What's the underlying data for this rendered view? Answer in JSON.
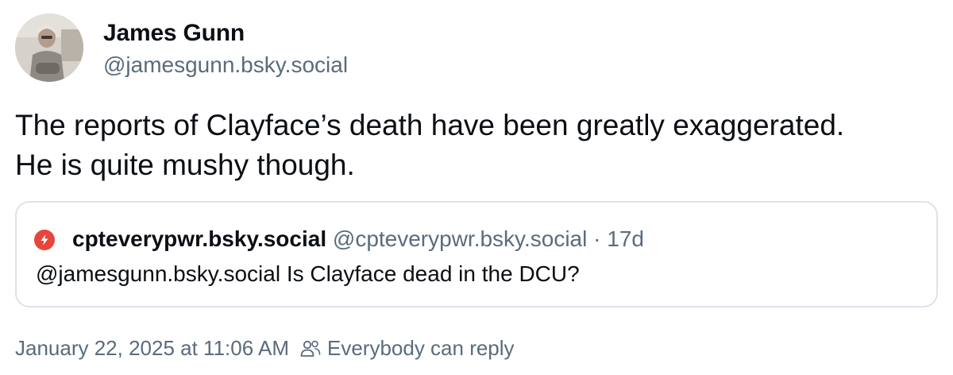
{
  "author": {
    "display_name": "James Gunn",
    "handle": "@jamesgunn.bsky.social",
    "avatar_icon": "profile-photo"
  },
  "post": {
    "text_lines": [
      "The reports of Clayface’s death have been greatly exaggerated.",
      "He is quite mushy though."
    ]
  },
  "quote": {
    "avatar_icon": "red-avatar-icon",
    "avatar_color": "#e8453c",
    "name": "cpteverypwr.bsky.social",
    "handle": "@cpteverypwr.bsky.social",
    "separator": " · ",
    "age": "17d",
    "text": "@jamesgunn.bsky.social Is Clayface dead in the DCU?"
  },
  "meta": {
    "timestamp": "January 22, 2025 at 11:06 AM",
    "reply_icon": "people-icon",
    "reply_setting": "Everybody can reply"
  }
}
